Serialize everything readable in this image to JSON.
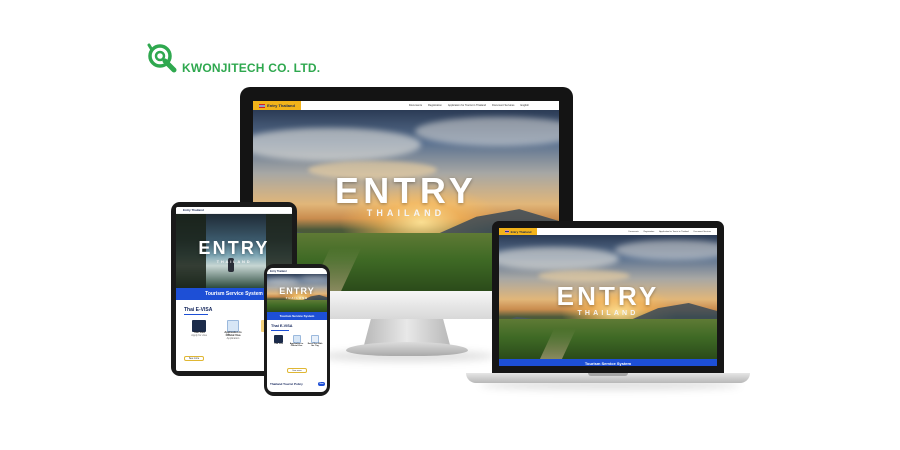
{
  "logo": {
    "company_part1": "KWONJITECH",
    "company_part2": " CO. LTD.",
    "brand_color": "#2fa84f",
    "icon": "kwonjitech-logo-icon"
  },
  "site": {
    "brand": "Entry Thailand",
    "nav_links": [
      "Documents",
      "Registration",
      "Application for Tourist in Thailand",
      "Document Services",
      "English"
    ],
    "hero_title": "ENTRY",
    "hero_subtitle": "THAILAND",
    "band_text": "Tourism Service System",
    "colors": {
      "brand_yellow": "#f2b31a",
      "band_blue": "#1d4fd6",
      "navy": "#12245a"
    }
  },
  "tablet": {
    "band_text": "Tourism Service System",
    "section_title": "Thai E-VISA",
    "cards": [
      {
        "name": "Thai Visa",
        "desc": "Apply for visa"
      },
      {
        "name": "Application to Official Visa",
        "desc": "Application"
      },
      {
        "name": "Stay",
        "desc": ""
      }
    ],
    "button": "See more"
  },
  "phone": {
    "band_text": "Tourism Service System",
    "section_title": "Thai E-VISA",
    "cards": [
      {
        "name": "Thai Visa",
        "desc": ""
      },
      {
        "name": "Application to Official Visa",
        "desc": ""
      },
      {
        "name": "Entry Visa With Ins. Tag",
        "desc": ""
      }
    ],
    "button": "See more",
    "footer_title": "Thailand Tourist Policy",
    "badge": "New"
  }
}
